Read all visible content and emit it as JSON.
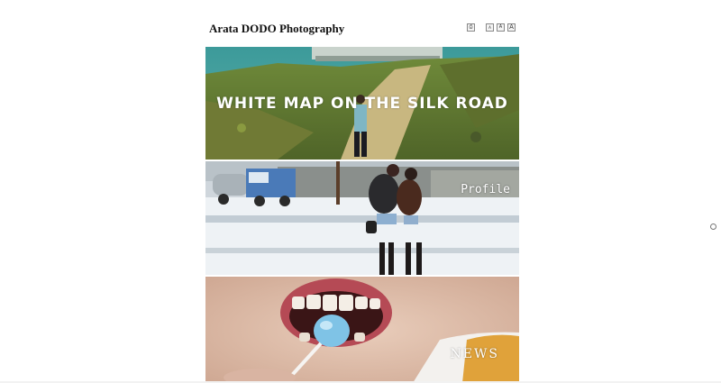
{
  "site": {
    "title": "Arata DODO Photography"
  },
  "toolbar": {
    "print_icon": "print-icon",
    "font_small_label": "A",
    "font_medium_label": "A",
    "font_large_label": "A"
  },
  "panels": [
    {
      "title": "WHITE MAP ON THE SILK ROAD"
    },
    {
      "title": "Profile"
    },
    {
      "title": "NEWS"
    }
  ],
  "colors": {
    "background": "#ffffff",
    "title_text": "#111111",
    "overlay_text": "#ffffff"
  }
}
